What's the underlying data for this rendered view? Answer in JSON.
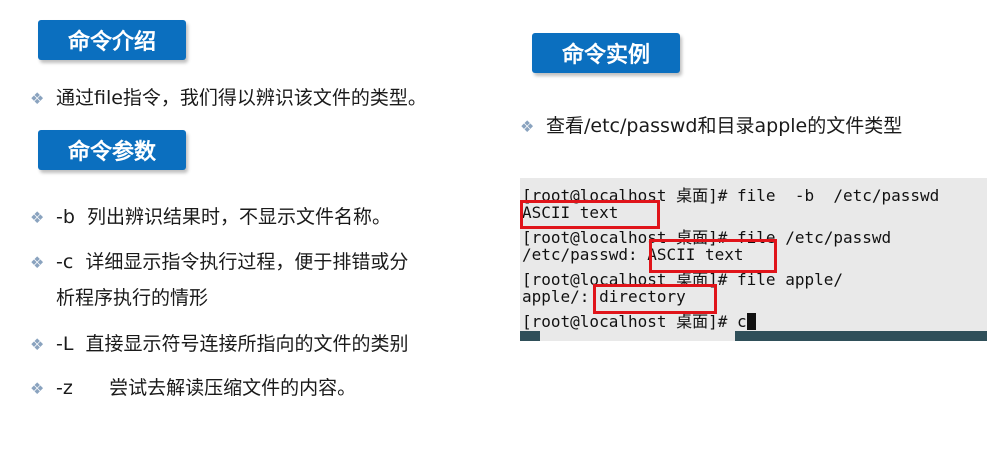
{
  "left": {
    "intro_title": "命令介绍",
    "intro_text": "通过file指令，我们得以辨识该文件的类型。",
    "params_title": "命令参数",
    "params": [
      {
        "flag": "-b",
        "desc": "列出辨识结果时，不显示文件名称。"
      },
      {
        "flag": "-c",
        "desc": "详细显示指令执行过程，便于排错或分",
        "desc_cont": "析程序执行的情形"
      },
      {
        "flag": "-L",
        "desc": "直接显示符号连接所指向的文件的类别"
      },
      {
        "flag": "-z",
        "desc": "尝试去解读压缩文件的内容。"
      }
    ]
  },
  "right": {
    "example_title": "命令实例",
    "example_text": "查看/etc/passwd和目录apple的文件类型",
    "terminal": [
      "[root@localhost 桌面]# file  -b  /etc/passwd",
      "ASCII text",
      "[root@localhost 桌面]# file /etc/passwd",
      "/etc/passwd: ASCII text",
      "[root@localhost 桌面]# file apple/",
      "apple/: directory",
      "[root@localhost 桌面]# c"
    ]
  }
}
